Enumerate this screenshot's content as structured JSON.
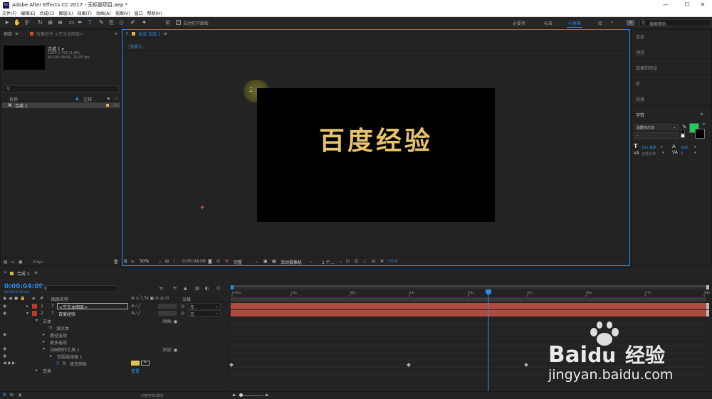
{
  "window": {
    "app_icon": "Ae",
    "title": "Adobe After Effects CC 2017 - 无标题项目.aep *",
    "controls": {
      "minimize": "—",
      "maximize": "☐",
      "close": "✕"
    }
  },
  "menu": [
    "文件(F)",
    "编辑(E)",
    "合成(C)",
    "图层(L)",
    "效果(T)",
    "动画(A)",
    "视图(V)",
    "窗口",
    "帮助(H)"
  ],
  "toolbar": {
    "auto_open_panel": "自动打开面板",
    "workspaces": [
      "必要项",
      "标准",
      "小屏幕",
      "库"
    ],
    "active_workspace": "小屏幕",
    "search_help": "搜索帮助"
  },
  "project_panel": {
    "title": "项目",
    "effects_tab": "效果控件 <空文本图层>",
    "comp_name": "合成 1 ▾",
    "comp_size": "1280 x 720 (1.00)",
    "comp_duration": "Δ 0:00:08:00, 25.00 fps",
    "col_name": "名称",
    "col_comment": "注释",
    "items": [
      {
        "name": "合成 1"
      }
    ],
    "bit_depth": "8 bpc"
  },
  "composition_panel": {
    "tab_label": "合成 合成 1",
    "breadcrumb": "合成 1",
    "text_on_canvas": "百度经验",
    "zoom": "50%",
    "timecode": "0:00:04:09",
    "resolution": "完整",
    "camera": "活动摄像机",
    "views": "1 个...",
    "exposure": "+0.0"
  },
  "right_panel": {
    "items": [
      "信息",
      "预览",
      "效果和预设",
      "库",
      "段落"
    ],
    "character_title": "字符",
    "font": "站酷快乐体",
    "font_size": "181 像素",
    "auto_leading": "自动",
    "tracking": "度量标准",
    "swatch_fill": "#19d05a",
    "swatch_stroke": "#000000"
  },
  "timeline": {
    "tab": "合成 1",
    "timecode": "0:00:04:09",
    "timecode_sub": "00109 (25.00 fps)",
    "col_name": "图层名称",
    "col_parent": "父级",
    "ruler": [
      "0:00s",
      "01s",
      "02s",
      "03s",
      "04s",
      "05s",
      "06s",
      "07s",
      "08s"
    ],
    "layers": [
      {
        "num": "1",
        "type": "T",
        "name": "<空文本图层>",
        "parent": "无"
      },
      {
        "num": "2",
        "type": "T",
        "name": "百度经验",
        "parent": "无"
      }
    ],
    "props": {
      "text": "文本",
      "animate": "动画: ●",
      "source_text": "源文本",
      "path_options": "路径选项",
      "more_options": "更多选项",
      "animator": "动画制作工具 1",
      "add": "添加: ●",
      "range_selector": "范围选择器 1",
      "fill_color": "填充颜色",
      "transform": "变换",
      "reset": "重置"
    },
    "footer": "切换开关/模式"
  },
  "watermark": {
    "brand": "Bai",
    "brand_du": "du",
    "brand_cn": "经验",
    "url": "jingyan.baidu.com"
  },
  "colors": {
    "accent": "#2d8ceb",
    "text_gold": "#e8c46a",
    "layer_bar": "#b14a40",
    "label_red": "#c0392b",
    "fill_swatch": "#e0c45a"
  }
}
